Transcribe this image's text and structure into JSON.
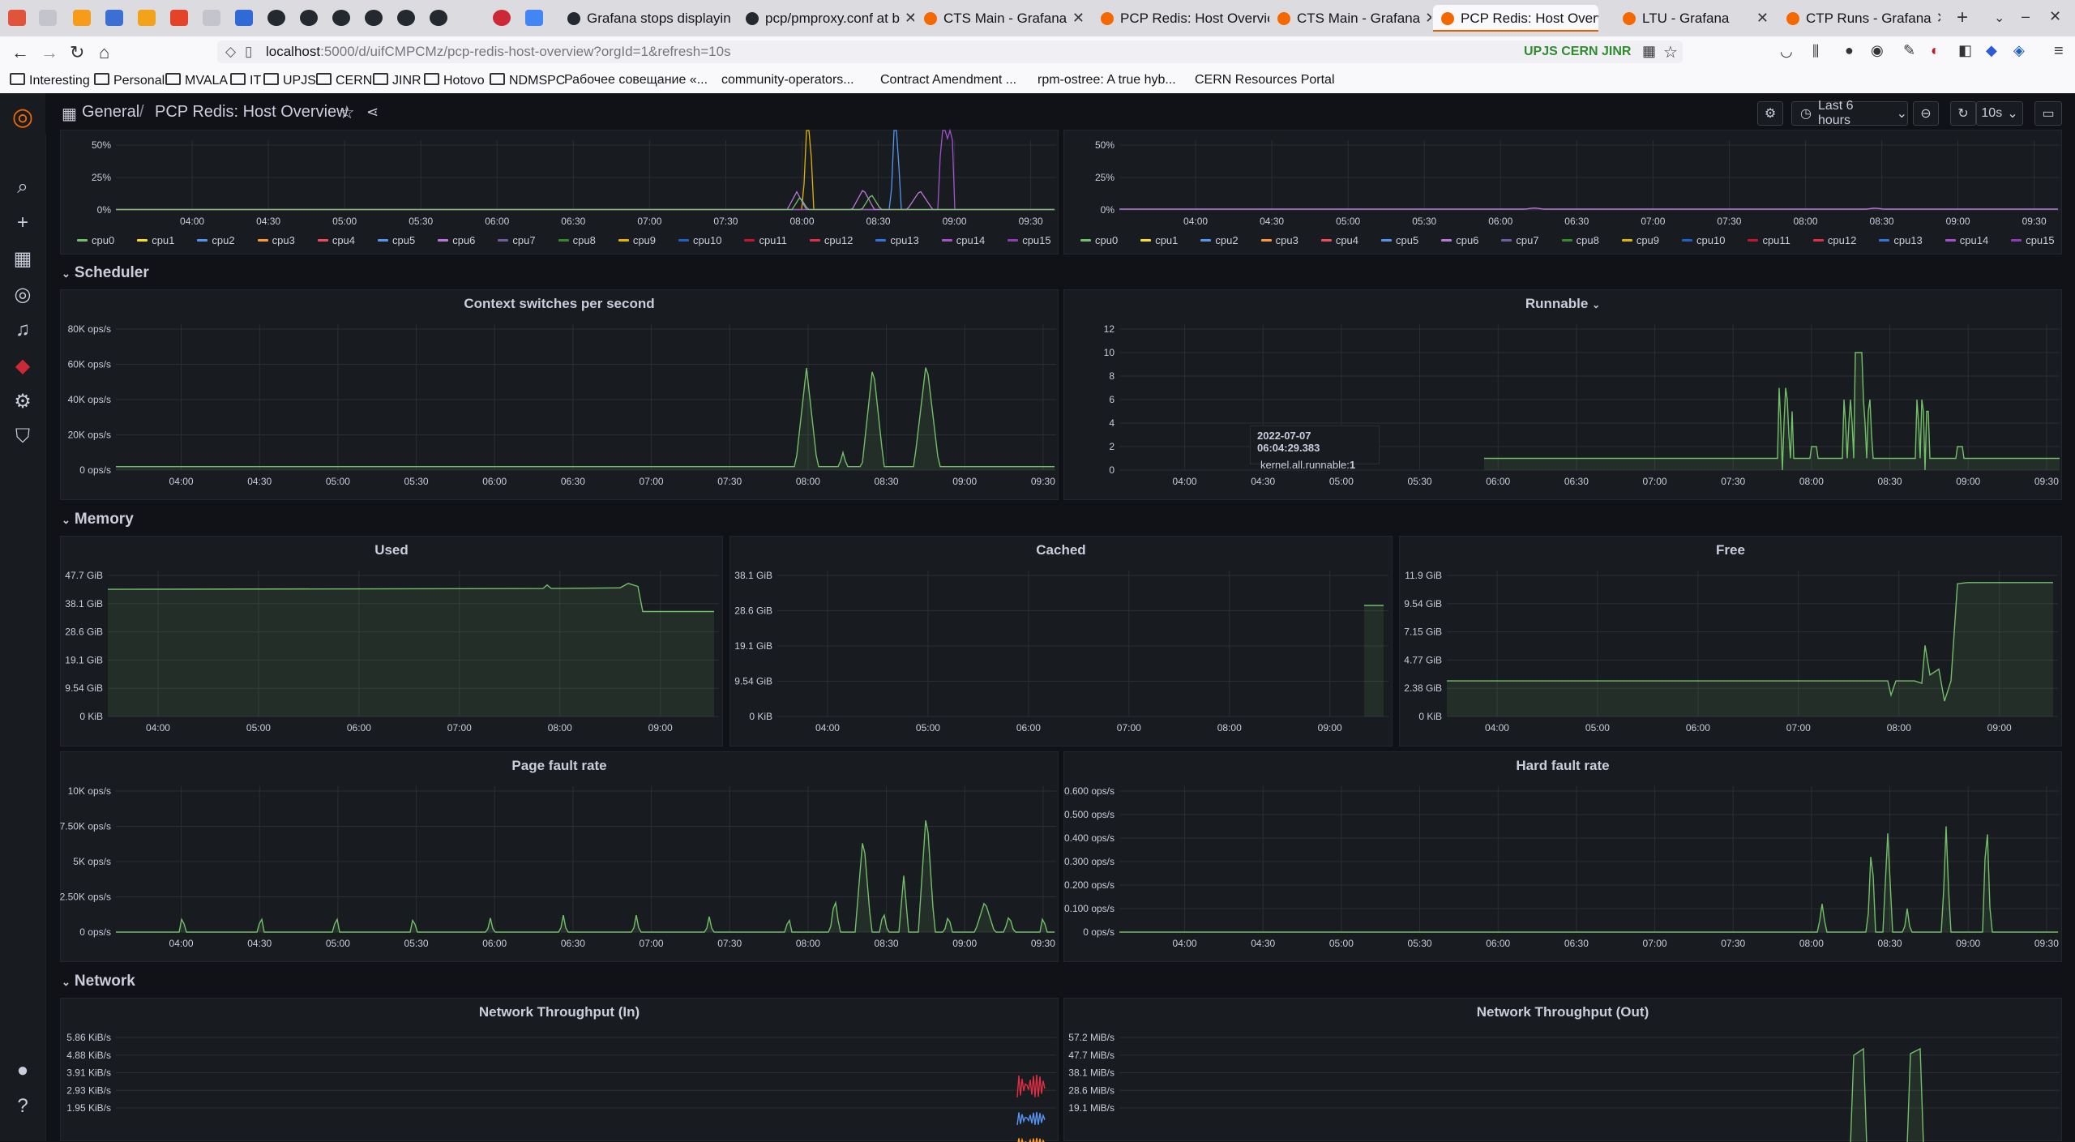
{
  "browser": {
    "tabs": [
      {
        "label": "Grafana stops displayin",
        "active": false
      },
      {
        "label": "pcp/pmproxy.conf at b",
        "active": false
      },
      {
        "label": "CTS Main - Grafana",
        "active": false
      },
      {
        "label": "PCP Redis: Host Overvie",
        "active": false
      },
      {
        "label": "CTS Main - Grafana",
        "active": false
      },
      {
        "label": "PCP Redis: Host Overvie",
        "active": true
      },
      {
        "label": "LTU - Grafana",
        "active": false
      },
      {
        "label": "CTP Runs - Grafana",
        "active": false
      }
    ],
    "url_host": "localhost",
    "url_rest": ":5000/d/uifCMPCMz/pcp-redis-host-overview?orgId=1&refresh=10s",
    "extension_badge": "UPJS CERN JINR",
    "bookmarks": [
      "Interesting",
      "Personal",
      "MVALA",
      "IT",
      "UPJS",
      "CERN",
      "JINR",
      "Hotovo",
      "NDMSPC",
      "Рабочее совещание «...",
      "community-operators...",
      "Contract Amendment ...",
      "rpm-ostree: A true hyb...",
      "CERN Resources Portal"
    ]
  },
  "grafana": {
    "breadcrumb_folder": "General",
    "breadcrumb_sep": "/",
    "dashboard_title": "PCP Redis: Host Overview",
    "time_range": "Last 6 hours",
    "refresh": "10s",
    "rows": {
      "scheduler": "Scheduler",
      "memory": "Memory",
      "network": "Network"
    },
    "legend_cpus": [
      {
        "name": "cpu0",
        "color": "#73bf69"
      },
      {
        "name": "cpu1",
        "color": "#fade2a"
      },
      {
        "name": "cpu2",
        "color": "#5794f2"
      },
      {
        "name": "cpu3",
        "color": "#ff9830"
      },
      {
        "name": "cpu4",
        "color": "#f2495c"
      },
      {
        "name": "cpu5",
        "color": "#5794f2"
      },
      {
        "name": "cpu6",
        "color": "#b877d9"
      },
      {
        "name": "cpu7",
        "color": "#705da0"
      },
      {
        "name": "cpu8",
        "color": "#37872d"
      },
      {
        "name": "cpu9",
        "color": "#e0b400"
      },
      {
        "name": "cpu10",
        "color": "#1f60c4"
      },
      {
        "name": "cpu11",
        "color": "#c4162a"
      },
      {
        "name": "cpu12",
        "color": "#e02f44"
      },
      {
        "name": "cpu13",
        "color": "#3274d9"
      },
      {
        "name": "cpu14",
        "color": "#a352cc"
      },
      {
        "name": "cpu15",
        "color": "#8f3bb8"
      }
    ],
    "tooltip": {
      "time": "2022-07-07 06:04:29.383",
      "series": "kernel.all.runnable:",
      "value": "1"
    }
  },
  "panels": [
    {
      "key": "cpu_left",
      "title": "",
      "x_ticks": [
        "04:00",
        "04:30",
        "05:00",
        "05:30",
        "06:00",
        "06:30",
        "07:00",
        "07:30",
        "08:00",
        "08:30",
        "09:00",
        "09:30"
      ],
      "y_ticks": [
        "0%",
        "25%",
        "50%"
      ],
      "ymax": 50
    },
    {
      "key": "cpu_right",
      "title": "",
      "x_ticks": [
        "04:00",
        "04:30",
        "05:00",
        "05:30",
        "06:00",
        "06:30",
        "07:00",
        "07:30",
        "08:00",
        "08:30",
        "09:00",
        "09:30"
      ],
      "y_ticks": [
        "0%",
        "25%",
        "50%"
      ],
      "ymax": 50
    },
    {
      "key": "ctx",
      "title": "Context switches per second",
      "x_ticks": [
        "04:00",
        "04:30",
        "05:00",
        "05:30",
        "06:00",
        "06:30",
        "07:00",
        "07:30",
        "08:00",
        "08:30",
        "09:00",
        "09:30"
      ],
      "y_ticks": [
        "0 ops/s",
        "20K ops/s",
        "40K ops/s",
        "60K ops/s",
        "80K ops/s"
      ],
      "ymax": 80000
    },
    {
      "key": "runnable",
      "title": "Runnable",
      "x_ticks": [
        "04:00",
        "04:30",
        "05:00",
        "05:30",
        "06:00",
        "06:30",
        "07:00",
        "07:30",
        "08:00",
        "08:30",
        "09:00",
        "09:30"
      ],
      "y_ticks": [
        "0",
        "2",
        "4",
        "6",
        "8",
        "10",
        "12"
      ],
      "ymax": 12
    },
    {
      "key": "used",
      "title": "Used",
      "x_ticks": [
        "04:00",
        "05:00",
        "06:00",
        "07:00",
        "08:00",
        "09:00"
      ],
      "y_ticks": [
        "0 KiB",
        "9.54 GiB",
        "19.1 GiB",
        "28.6 GiB",
        "38.1 GiB",
        "47.7 GiB"
      ],
      "ymax": 47.7
    },
    {
      "key": "cached",
      "title": "Cached",
      "x_ticks": [
        "04:00",
        "05:00",
        "06:00",
        "07:00",
        "08:00",
        "09:00"
      ],
      "y_ticks": [
        "0 KiB",
        "9.54 GiB",
        "19.1 GiB",
        "28.6 GiB",
        "38.1 GiB"
      ],
      "ymax": 38.1
    },
    {
      "key": "free",
      "title": "Free",
      "x_ticks": [
        "04:00",
        "05:00",
        "06:00",
        "07:00",
        "08:00",
        "09:00"
      ],
      "y_ticks": [
        "0 KiB",
        "2.38 GiB",
        "4.77 GiB",
        "7.15 GiB",
        "9.54 GiB",
        "11.9 GiB"
      ],
      "ymax": 11.9
    },
    {
      "key": "pagefault",
      "title": "Page fault rate",
      "x_ticks": [
        "04:00",
        "04:30",
        "05:00",
        "05:30",
        "06:00",
        "06:30",
        "07:00",
        "07:30",
        "08:00",
        "08:30",
        "09:00",
        "09:30"
      ],
      "y_ticks": [
        "0 ops/s",
        "2.50K ops/s",
        "5K ops/s",
        "7.50K ops/s",
        "10K ops/s"
      ],
      "ymax": 10000
    },
    {
      "key": "hardfault",
      "title": "Hard fault rate",
      "x_ticks": [
        "04:00",
        "04:30",
        "05:00",
        "05:30",
        "06:00",
        "06:30",
        "07:00",
        "07:30",
        "08:00",
        "08:30",
        "09:00",
        "09:30"
      ],
      "y_ticks": [
        "0 ops/s",
        "0.100 ops/s",
        "0.200 ops/s",
        "0.300 ops/s",
        "0.400 ops/s",
        "0.500 ops/s",
        "0.600 ops/s"
      ],
      "ymax": 0.6
    },
    {
      "key": "netin",
      "title": "Network Throughput (In)",
      "x_ticks": [],
      "y_ticks": [
        "1.95 KiB/s",
        "2.93 KiB/s",
        "3.91 KiB/s",
        "4.88 KiB/s",
        "5.86 KiB/s"
      ],
      "ymax": 5.86
    },
    {
      "key": "netout",
      "title": "Network Throughput (Out)",
      "x_ticks": [],
      "y_ticks": [
        "19.1 MiB/s",
        "28.6 MiB/s",
        "38.1 MiB/s",
        "47.7 MiB/s",
        "57.2 MiB/s"
      ],
      "ymax": 57.2
    }
  ],
  "chart_data": [
    {
      "type": "line",
      "title": "Context switches per second",
      "unit": "ops/s",
      "x": [
        "08:00",
        "08:15",
        "08:30",
        "08:50",
        "09:30"
      ],
      "series": [
        {
          "values": [
            58000,
            10000,
            60000,
            62000,
            2000
          ]
        }
      ]
    },
    {
      "type": "line",
      "title": "Runnable",
      "x": [
        "06:00",
        "08:00",
        "08:30",
        "08:50",
        "09:30"
      ],
      "series": [
        {
          "name": "kernel.all.runnable",
          "values": [
            1,
            7,
            10,
            6,
            1
          ]
        }
      ]
    },
    {
      "type": "area",
      "title": "Used",
      "unit": "GiB",
      "x": [
        "04:00",
        "08:00",
        "08:45",
        "09:00",
        "09:30"
      ],
      "series": [
        {
          "values": [
            43,
            43.5,
            45,
            35,
            35
          ]
        }
      ]
    },
    {
      "type": "area",
      "title": "Cached",
      "unit": "GiB",
      "x": [
        "09:20",
        "09:30"
      ],
      "series": [
        {
          "values": [
            30,
            30
          ]
        }
      ]
    },
    {
      "type": "area",
      "title": "Free",
      "unit": "GiB",
      "x": [
        "04:00",
        "08:00",
        "08:30",
        "08:50",
        "09:00",
        "09:30"
      ],
      "series": [
        {
          "values": [
            3,
            3,
            6,
            1,
            11.3,
            11.3
          ]
        }
      ]
    },
    {
      "type": "line",
      "title": "Page fault rate",
      "unit": "ops/s",
      "x": [
        "08:00",
        "08:25",
        "08:40",
        "09:30"
      ],
      "series": [
        {
          "values": [
            6500,
            8800,
            2000,
            800
          ]
        }
      ]
    },
    {
      "type": "line",
      "title": "Hard fault rate",
      "unit": "ops/s",
      "x": [
        "08:10",
        "08:30",
        "08:35",
        "09:10",
        "09:20"
      ],
      "series": [
        {
          "values": [
            0.12,
            0.4,
            0.42,
            0.45,
            0.52
          ]
        }
      ]
    }
  ]
}
